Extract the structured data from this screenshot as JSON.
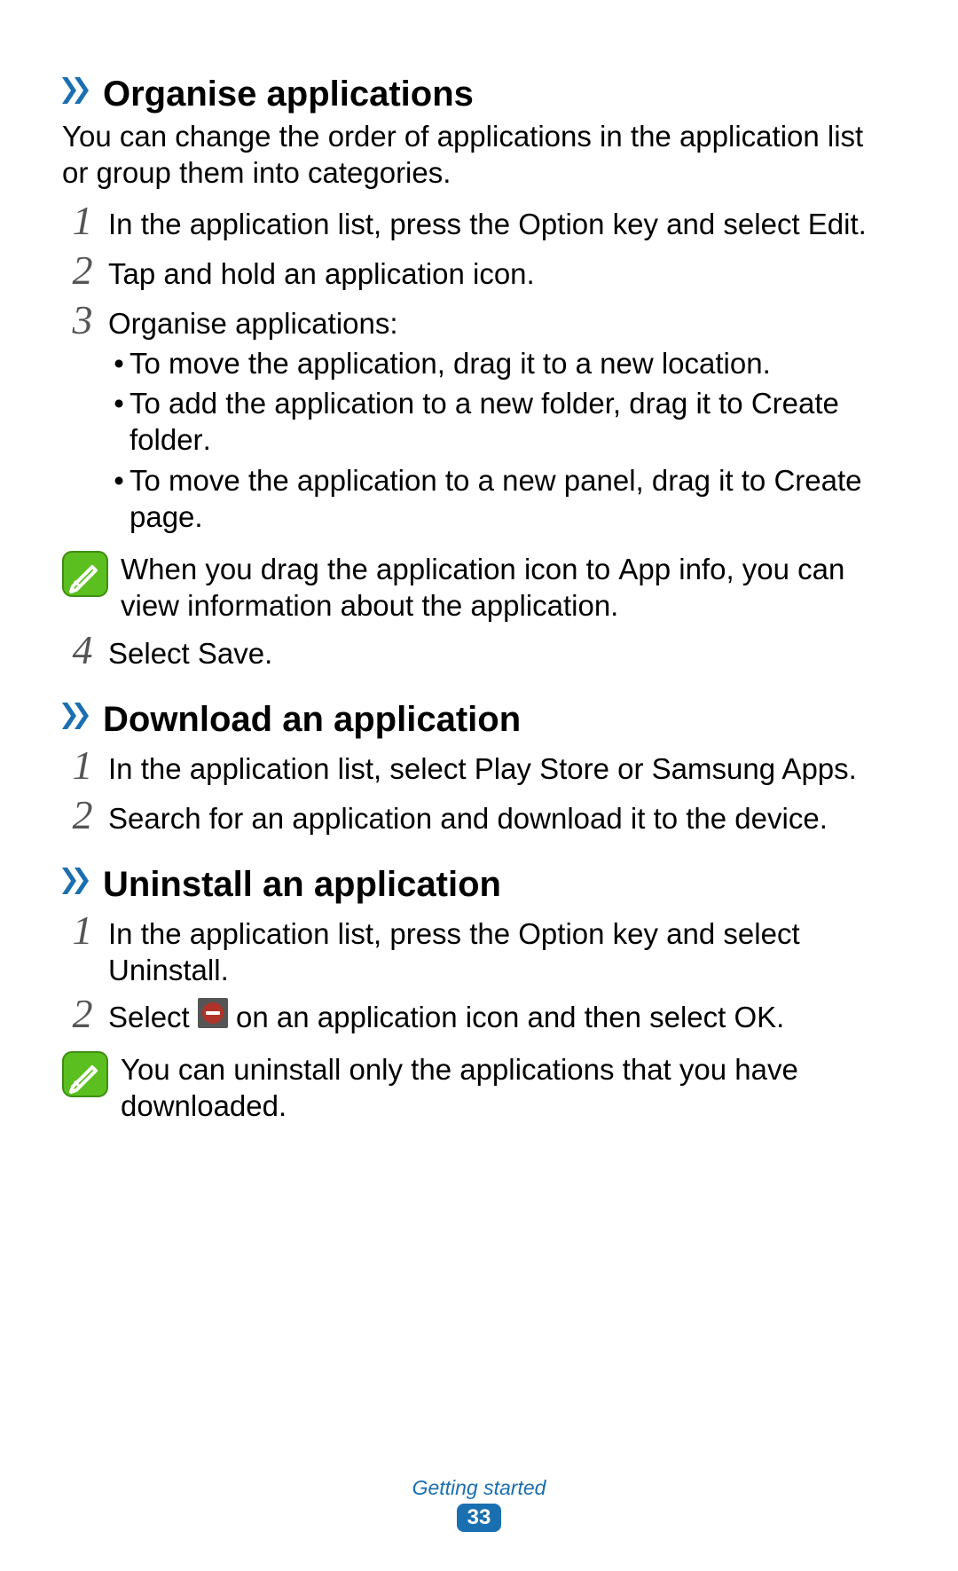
{
  "sections": {
    "organise": {
      "title": "Organise applications",
      "intro": "You can change the order of applications in the application list or group them into categories.",
      "step1_pre": "In the application list, press the Option key and select ",
      "step1_sans": "Edit",
      "step1_post": ".",
      "step2": "Tap and hold an application icon.",
      "step3_intro": "Organise applications:",
      "bullet1": "To move the application, drag it to a new location.",
      "bullet2_pre": "To add the application to a new folder, drag it to ",
      "bullet2_sans": "Create folder",
      "bullet2_post": ".",
      "bullet3_pre": "To move the application to a new panel, drag it to ",
      "bullet3_sans": "Create page",
      "bullet3_post": ".",
      "note_pre": "When you drag the application icon to ",
      "note_sans": "App info",
      "note_post": ", you can view information about the application.",
      "step4_pre": "Select ",
      "step4_sans": "Save",
      "step4_post": "."
    },
    "download": {
      "title": "Download an application",
      "step1_pre": "In the application list, select ",
      "step1_sans1": "Play Store",
      "step1_mid": " or ",
      "step1_sans2": "Samsung Apps",
      "step1_post": ".",
      "step2": "Search for an application and download it to the device."
    },
    "uninstall": {
      "title": "Uninstall an application",
      "step1_pre": "In the application list, press the Option key and select ",
      "step1_sans": "Uninstall",
      "step1_post": ".",
      "step2_pre": "Select ",
      "step2_mid": " on an application icon and then select ",
      "step2_sans": "OK",
      "step2_post": ".",
      "note": "You can uninstall only the applications that you have downloaded."
    }
  },
  "nums": {
    "n1": "1",
    "n2": "2",
    "n3": "3",
    "n4": "4"
  },
  "bullet_dot": "•",
  "footer": {
    "section": "Getting started",
    "page": "33"
  }
}
